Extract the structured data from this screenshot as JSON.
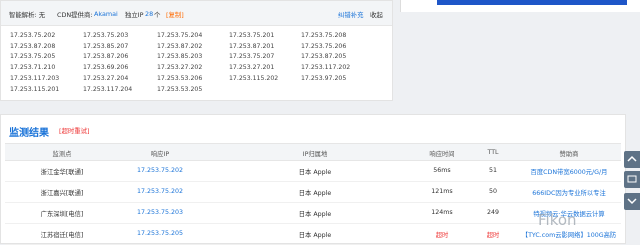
{
  "info_bar": {
    "smart_dns_label": "智能解析: 无",
    "cdn_provider_label": "CDN提供商:",
    "cdn_provider_value": "Akamai",
    "ip_count_label": "独立IP",
    "ip_count_value": "28",
    "ip_count_unit": "个",
    "copy_label": "[复制]",
    "report_error": "纠错补充",
    "collapse": "收起"
  },
  "ip_grid": [
    [
      "17.253.75.202",
      "17.253.75.203",
      "17.253.75.204",
      "17.253.75.201",
      "17.253.75.208"
    ],
    [
      "17.253.87.208",
      "17.253.85.207",
      "17.253.87.202",
      "17.253.87.201",
      "17.253.75.206"
    ],
    [
      "17.253.75.205",
      "17.253.87.206",
      "17.253.85.203",
      "17.253.75.207",
      "17.253.87.205"
    ],
    [
      "17.253.71.210",
      "17.253.69.206",
      "17.253.27.202",
      "17.253.27.201",
      "17.253.117.202"
    ],
    [
      "17.253.117.203",
      "17.253.27.204",
      "17.253.53.206",
      "17.253.115.202",
      "17.253.97.205"
    ],
    [
      "17.253.115.201",
      "17.253.117.204",
      "17.253.53.205",
      "",
      ""
    ]
  ],
  "results": {
    "title": "监测结果",
    "retest": "[超时重试]",
    "headers": [
      "监测点",
      "响应IP",
      "IP归属地",
      "响应时间",
      "TTL",
      "赞助商"
    ],
    "rows": [
      {
        "node": "浙江金华[联通]",
        "ip": "17.253.75.202",
        "location": "日本 Apple",
        "time": "56ms",
        "ttl": "51",
        "sponsor": "百度CDN带宽6000元/G/月",
        "timeout": false
      },
      {
        "node": "浙江嘉兴[联通]",
        "ip": "17.253.75.202",
        "location": "日本 Apple",
        "time": "121ms",
        "ttl": "50",
        "sponsor": "666IDC因为专业所以专注",
        "timeout": false
      },
      {
        "node": "广东深圳[电信]",
        "ip": "17.253.75.203",
        "location": "日本 Apple",
        "time": "124ms",
        "ttl": "249",
        "sponsor": "特视频云·华云数据云计算",
        "timeout": false
      },
      {
        "node": "江苏宿迁[电信]",
        "ip": "17.253.75.205",
        "location": "日本 Apple",
        "time": "超时",
        "ttl": "超时",
        "sponsor": "【TYC.com云影网络】100G高防",
        "timeout": true
      }
    ]
  },
  "watermark": "Fikon",
  "colors": {
    "accent": "#1a73d8",
    "warning": "#e33",
    "copy": "#ff6a00"
  }
}
